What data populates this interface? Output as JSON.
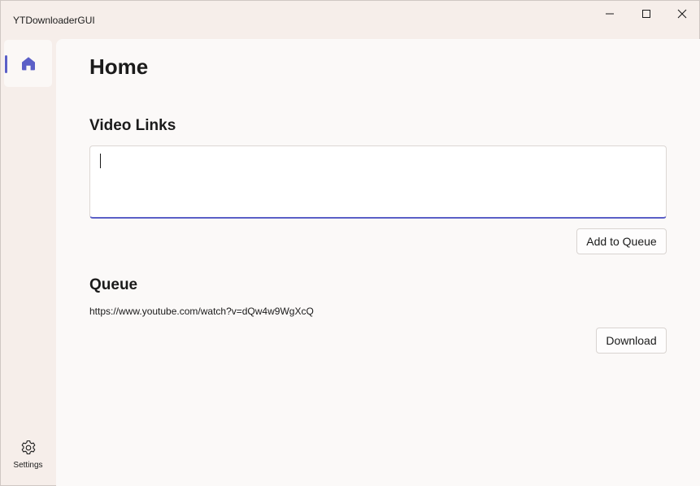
{
  "window": {
    "title": "YTDownloaderGUI"
  },
  "sidebar": {
    "items": [
      {
        "icon": "home-icon",
        "label": "Home",
        "selected": true
      },
      {
        "icon": "gear-icon",
        "label": "Settings"
      }
    ]
  },
  "main": {
    "page_title": "Home",
    "video_links": {
      "heading": "Video Links",
      "value": ""
    },
    "add_button_label": "Add to Queue",
    "queue": {
      "heading": "Queue",
      "items": [
        "https://www.youtube.com/watch?v=dQw4w9WgXcQ"
      ]
    },
    "download_button_label": "Download"
  },
  "colors": {
    "accent": "#5b5fc7",
    "sidebar_bg": "#f6eeea",
    "content_bg": "#fbf9f8"
  }
}
